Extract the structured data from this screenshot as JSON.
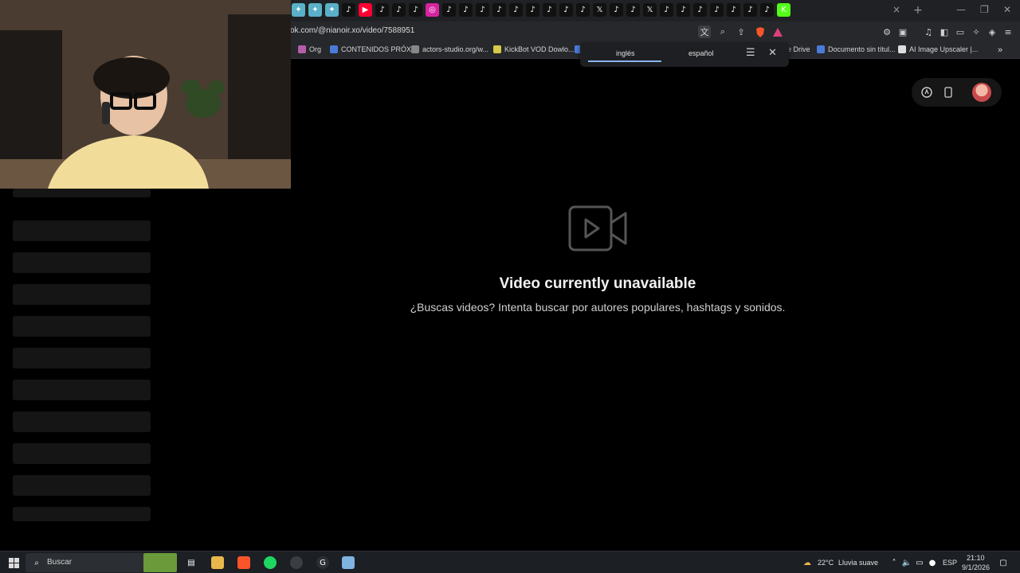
{
  "browser": {
    "url": "ok.com/@nianoir.xo/video/7588951",
    "tabs": [
      "tab",
      "tab",
      "tab",
      "tiktok",
      "youtube",
      "tiktok",
      "tiktok",
      "tiktok",
      "instagram",
      "tiktok",
      "tiktok",
      "tiktok",
      "tiktok",
      "tiktok",
      "tiktok",
      "tiktok",
      "tiktok",
      "tiktok",
      "x",
      "tiktok",
      "tiktok",
      "x",
      "tiktok",
      "tiktok",
      "tiktok",
      "tiktok",
      "tiktok",
      "tiktok",
      "tiktok",
      "kick"
    ],
    "active_tab_close": "×",
    "new_tab": "+"
  },
  "bookmarks": [
    {
      "label": "Org",
      "color": "#b35ea8"
    },
    {
      "label": "CONTENIDOS PRÓX...",
      "color": "#4a7bd8"
    },
    {
      "label": "actors-studio.org/w...",
      "color": "#888888"
    },
    {
      "label": "KickBot VOD Dowlo...",
      "color": "#d7c94a"
    },
    {
      "label": "",
      "color": "#4a7bd8"
    },
    {
      "label": "e Drive",
      "color": ""
    },
    {
      "label": "Documento sin títul...",
      "color": "#4a7bd8"
    },
    {
      "label": "AI Image Upscaler |...",
      "color": "#dddddd"
    }
  ],
  "translate_popup": {
    "tab_source": "inglés",
    "tab_target": "español"
  },
  "page": {
    "title": "Video currently unavailable",
    "subtitle": "¿Buscas videos? Intenta buscar por autores populares, hashtags y sonidos."
  },
  "taskbar": {
    "search_label": "Buscar",
    "weather_temp": "22°C",
    "weather_desc": "Lluvia suave",
    "lang": "ESP",
    "time": "21:10",
    "date": "9/1/2026"
  }
}
